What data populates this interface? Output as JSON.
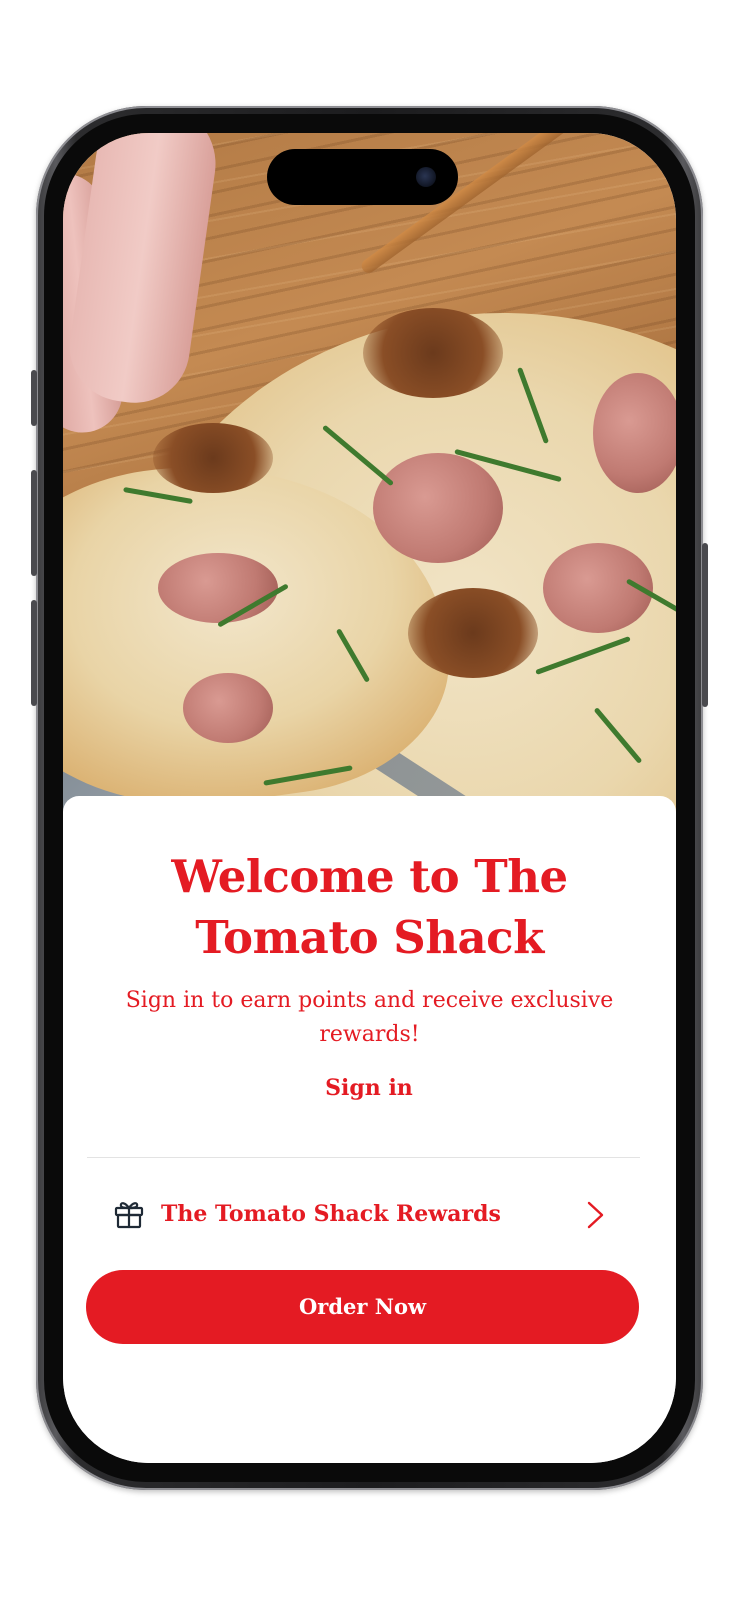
{
  "welcome": {
    "title": "Welcome to The Tomato Shack",
    "subtitle": "Sign in to earn points and receive exclusive rewards!",
    "signin_label": "Sign in"
  },
  "rewards": {
    "label": "The Tomato Shack Rewards",
    "icon": "gift-icon",
    "trailing_icon": "chevron-right-icon"
  },
  "order": {
    "label": "Order Now"
  },
  "colors": {
    "brand_red": "#e41b23",
    "icon_dark": "#1f2a36",
    "divider": "#e3e3e3"
  }
}
